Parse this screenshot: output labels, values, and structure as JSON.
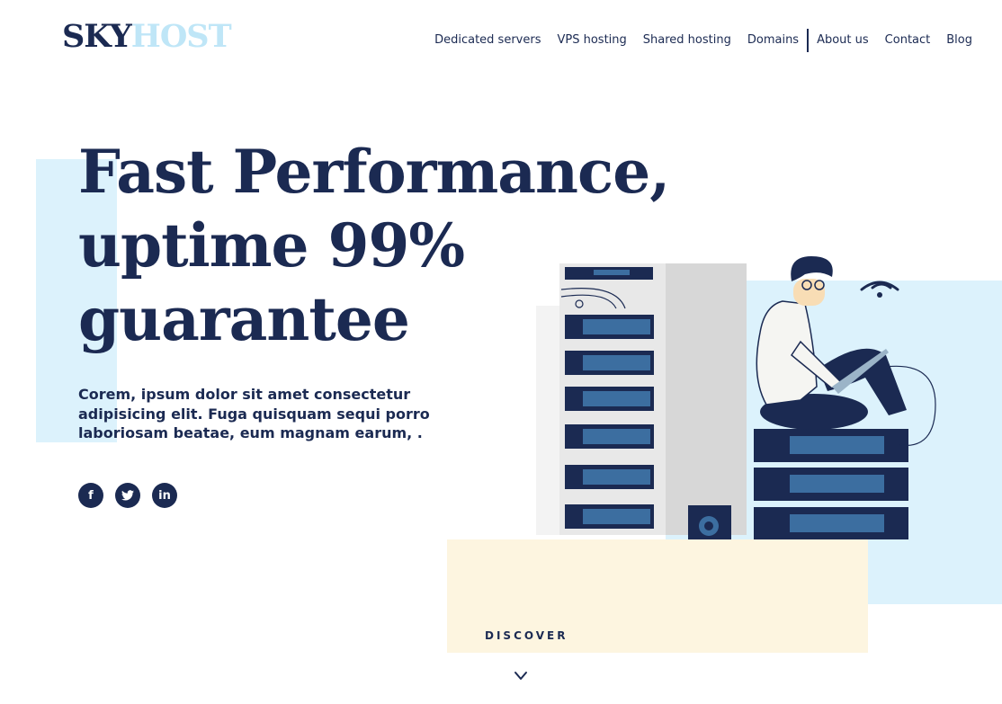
{
  "brand": {
    "part1": "SKY",
    "part2": "HOST",
    "color_primary": "#1b2a52",
    "color_light": "#bfe6f7"
  },
  "nav": {
    "items": [
      "Dedicated servers",
      "VPS hosting",
      "Shared hosting",
      "Domains",
      "About us",
      "Contact",
      "Blog"
    ]
  },
  "hero": {
    "title_lines": [
      "Fast Performance,",
      "uptime 99%",
      "guarantee"
    ],
    "subtitle": "Corem, ipsum dolor sit amet consectetur adipisicing elit. Fuga quisquam sequi porro laboriosam beatae, eum magnam earum, ."
  },
  "social": {
    "icons": [
      {
        "name": "facebook-icon",
        "glyph": "f"
      },
      {
        "name": "twitter-icon",
        "glyph": "t"
      },
      {
        "name": "linkedin-icon",
        "glyph": "in"
      }
    ]
  },
  "discover": {
    "label": "DISCOVER",
    "icon": "chevron-down-icon"
  },
  "colors": {
    "accent_blue": "#dcf2fc",
    "accent_cream": "#fdf5e0",
    "navy": "#1b2a52"
  }
}
